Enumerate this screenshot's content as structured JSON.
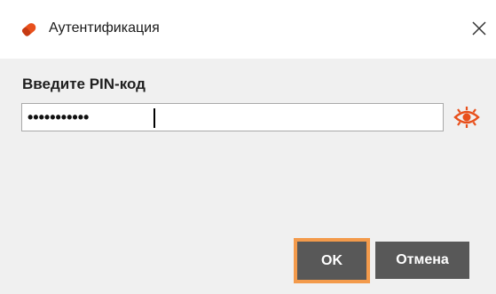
{
  "window": {
    "title": "Аутентификация",
    "close_glyph": "✕"
  },
  "form": {
    "prompt": "Введите PIN-код",
    "pin_masked": "•••••••••••",
    "show_pin_icon": "eye-icon"
  },
  "buttons": {
    "ok_label": "OK",
    "cancel_label": "Отмена"
  },
  "colors": {
    "accent": "#e8501c",
    "focus_ring": "#f39a4b",
    "button_bg": "#585858"
  }
}
